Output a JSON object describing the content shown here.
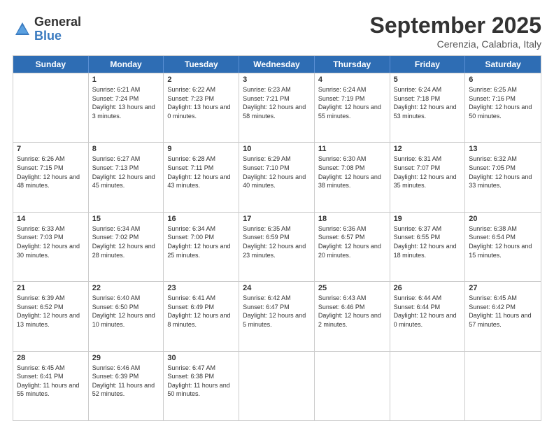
{
  "logo": {
    "general": "General",
    "blue": "Blue"
  },
  "title": "September 2025",
  "location": "Cerenzia, Calabria, Italy",
  "days_of_week": [
    "Sunday",
    "Monday",
    "Tuesday",
    "Wednesday",
    "Thursday",
    "Friday",
    "Saturday"
  ],
  "weeks": [
    [
      {
        "day": "",
        "sunrise": "",
        "sunset": "",
        "daylight": ""
      },
      {
        "day": "1",
        "sunrise": "Sunrise: 6:21 AM",
        "sunset": "Sunset: 7:24 PM",
        "daylight": "Daylight: 13 hours and 3 minutes."
      },
      {
        "day": "2",
        "sunrise": "Sunrise: 6:22 AM",
        "sunset": "Sunset: 7:23 PM",
        "daylight": "Daylight: 13 hours and 0 minutes."
      },
      {
        "day": "3",
        "sunrise": "Sunrise: 6:23 AM",
        "sunset": "Sunset: 7:21 PM",
        "daylight": "Daylight: 12 hours and 58 minutes."
      },
      {
        "day": "4",
        "sunrise": "Sunrise: 6:24 AM",
        "sunset": "Sunset: 7:19 PM",
        "daylight": "Daylight: 12 hours and 55 minutes."
      },
      {
        "day": "5",
        "sunrise": "Sunrise: 6:24 AM",
        "sunset": "Sunset: 7:18 PM",
        "daylight": "Daylight: 12 hours and 53 minutes."
      },
      {
        "day": "6",
        "sunrise": "Sunrise: 6:25 AM",
        "sunset": "Sunset: 7:16 PM",
        "daylight": "Daylight: 12 hours and 50 minutes."
      }
    ],
    [
      {
        "day": "7",
        "sunrise": "Sunrise: 6:26 AM",
        "sunset": "Sunset: 7:15 PM",
        "daylight": "Daylight: 12 hours and 48 minutes."
      },
      {
        "day": "8",
        "sunrise": "Sunrise: 6:27 AM",
        "sunset": "Sunset: 7:13 PM",
        "daylight": "Daylight: 12 hours and 45 minutes."
      },
      {
        "day": "9",
        "sunrise": "Sunrise: 6:28 AM",
        "sunset": "Sunset: 7:11 PM",
        "daylight": "Daylight: 12 hours and 43 minutes."
      },
      {
        "day": "10",
        "sunrise": "Sunrise: 6:29 AM",
        "sunset": "Sunset: 7:10 PM",
        "daylight": "Daylight: 12 hours and 40 minutes."
      },
      {
        "day": "11",
        "sunrise": "Sunrise: 6:30 AM",
        "sunset": "Sunset: 7:08 PM",
        "daylight": "Daylight: 12 hours and 38 minutes."
      },
      {
        "day": "12",
        "sunrise": "Sunrise: 6:31 AM",
        "sunset": "Sunset: 7:07 PM",
        "daylight": "Daylight: 12 hours and 35 minutes."
      },
      {
        "day": "13",
        "sunrise": "Sunrise: 6:32 AM",
        "sunset": "Sunset: 7:05 PM",
        "daylight": "Daylight: 12 hours and 33 minutes."
      }
    ],
    [
      {
        "day": "14",
        "sunrise": "Sunrise: 6:33 AM",
        "sunset": "Sunset: 7:03 PM",
        "daylight": "Daylight: 12 hours and 30 minutes."
      },
      {
        "day": "15",
        "sunrise": "Sunrise: 6:34 AM",
        "sunset": "Sunset: 7:02 PM",
        "daylight": "Daylight: 12 hours and 28 minutes."
      },
      {
        "day": "16",
        "sunrise": "Sunrise: 6:34 AM",
        "sunset": "Sunset: 7:00 PM",
        "daylight": "Daylight: 12 hours and 25 minutes."
      },
      {
        "day": "17",
        "sunrise": "Sunrise: 6:35 AM",
        "sunset": "Sunset: 6:59 PM",
        "daylight": "Daylight: 12 hours and 23 minutes."
      },
      {
        "day": "18",
        "sunrise": "Sunrise: 6:36 AM",
        "sunset": "Sunset: 6:57 PM",
        "daylight": "Daylight: 12 hours and 20 minutes."
      },
      {
        "day": "19",
        "sunrise": "Sunrise: 6:37 AM",
        "sunset": "Sunset: 6:55 PM",
        "daylight": "Daylight: 12 hours and 18 minutes."
      },
      {
        "day": "20",
        "sunrise": "Sunrise: 6:38 AM",
        "sunset": "Sunset: 6:54 PM",
        "daylight": "Daylight: 12 hours and 15 minutes."
      }
    ],
    [
      {
        "day": "21",
        "sunrise": "Sunrise: 6:39 AM",
        "sunset": "Sunset: 6:52 PM",
        "daylight": "Daylight: 12 hours and 13 minutes."
      },
      {
        "day": "22",
        "sunrise": "Sunrise: 6:40 AM",
        "sunset": "Sunset: 6:50 PM",
        "daylight": "Daylight: 12 hours and 10 minutes."
      },
      {
        "day": "23",
        "sunrise": "Sunrise: 6:41 AM",
        "sunset": "Sunset: 6:49 PM",
        "daylight": "Daylight: 12 hours and 8 minutes."
      },
      {
        "day": "24",
        "sunrise": "Sunrise: 6:42 AM",
        "sunset": "Sunset: 6:47 PM",
        "daylight": "Daylight: 12 hours and 5 minutes."
      },
      {
        "day": "25",
        "sunrise": "Sunrise: 6:43 AM",
        "sunset": "Sunset: 6:46 PM",
        "daylight": "Daylight: 12 hours and 2 minutes."
      },
      {
        "day": "26",
        "sunrise": "Sunrise: 6:44 AM",
        "sunset": "Sunset: 6:44 PM",
        "daylight": "Daylight: 12 hours and 0 minutes."
      },
      {
        "day": "27",
        "sunrise": "Sunrise: 6:45 AM",
        "sunset": "Sunset: 6:42 PM",
        "daylight": "Daylight: 11 hours and 57 minutes."
      }
    ],
    [
      {
        "day": "28",
        "sunrise": "Sunrise: 6:45 AM",
        "sunset": "Sunset: 6:41 PM",
        "daylight": "Daylight: 11 hours and 55 minutes."
      },
      {
        "day": "29",
        "sunrise": "Sunrise: 6:46 AM",
        "sunset": "Sunset: 6:39 PM",
        "daylight": "Daylight: 11 hours and 52 minutes."
      },
      {
        "day": "30",
        "sunrise": "Sunrise: 6:47 AM",
        "sunset": "Sunset: 6:38 PM",
        "daylight": "Daylight: 11 hours and 50 minutes."
      },
      {
        "day": "",
        "sunrise": "",
        "sunset": "",
        "daylight": ""
      },
      {
        "day": "",
        "sunrise": "",
        "sunset": "",
        "daylight": ""
      },
      {
        "day": "",
        "sunrise": "",
        "sunset": "",
        "daylight": ""
      },
      {
        "day": "",
        "sunrise": "",
        "sunset": "",
        "daylight": ""
      }
    ]
  ]
}
